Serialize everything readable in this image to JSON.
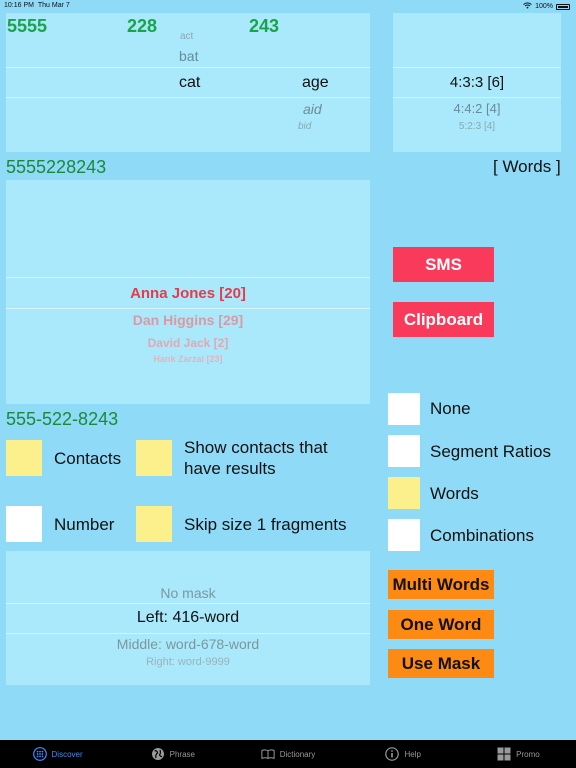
{
  "status": {
    "time": "10:16 PM",
    "date": "Thu Mar 7",
    "battery": "100%"
  },
  "top_panel": {
    "g1": "5555",
    "g2": "228",
    "g3": "243",
    "w_act": "act",
    "w_bat": "bat",
    "w_cat": "cat",
    "w_age": "age",
    "w_aid": "aid",
    "w_bid": "bid"
  },
  "ratio_panel": {
    "r1": "4:3:3  [6]",
    "r2": "4:4:2  [4]",
    "r3": "5:2:3  [4]"
  },
  "number_line": "5555228243",
  "words_link": "[ Words ]",
  "contacts": [
    {
      "name": "Anna Jones  [20]"
    },
    {
      "name": "Dan Higgins  [29]"
    },
    {
      "name": "David Jack  [2]"
    },
    {
      "name": "Hank Zarzai  [23]"
    }
  ],
  "formatted_number": "555-522-8243",
  "buttons": {
    "sms": "SMS",
    "clipboard": "Clipboard",
    "multi_words": "Multi Words",
    "one_word": "One Word",
    "use_mask": "Use Mask"
  },
  "options": {
    "contacts": "Contacts",
    "show_contacts": "Show contacts that have results",
    "number": "Number",
    "skip_size": "Skip size 1 fragments"
  },
  "modes": {
    "none": "None",
    "segment_ratios": "Segment Ratios",
    "words": "Words",
    "combinations": "Combinations"
  },
  "mask_panel": {
    "no_mask": "No mask",
    "left": "Left: 416-word",
    "middle": "Middle: word-678-word",
    "right": "Right: word-9999"
  },
  "tabs": [
    {
      "label": "Discover",
      "icon": "grid-icon"
    },
    {
      "label": "Phrase",
      "icon": "globe-icon"
    },
    {
      "label": "Dictionary",
      "icon": "book-icon"
    },
    {
      "label": "Help",
      "icon": "info-icon"
    },
    {
      "label": "Promo",
      "icon": "promo-grid-icon"
    }
  ],
  "colors": {
    "background": "#8fdaf7",
    "panel": "#a9e9fb",
    "green": "#1aa34a",
    "red": "#f93a5a",
    "orange": "#fd8a13",
    "yellow": "#fbf08c",
    "active_tab": "#3c8cff"
  }
}
